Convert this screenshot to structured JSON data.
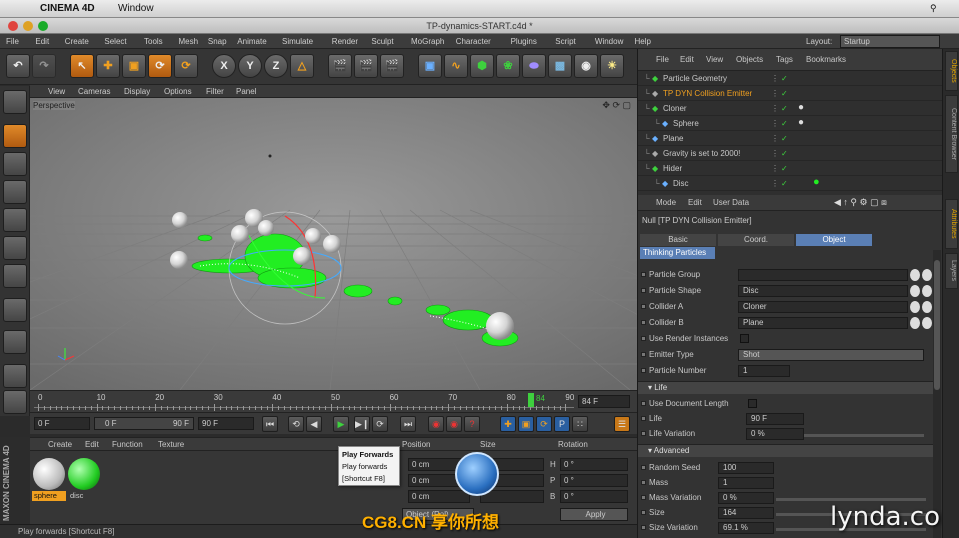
{
  "mac_menu": {
    "app": "CINEMA 4D",
    "window": "Window"
  },
  "window_title": "TP-dynamics-START.c4d *",
  "main_menu": [
    "File",
    "Edit",
    "Create",
    "Select",
    "Tools",
    "Mesh",
    "Snap",
    "Animate",
    "Simulate",
    "Render",
    "Sculpt",
    "MoGraph",
    "Character",
    "Plugins",
    "Script",
    "Window",
    "Help"
  ],
  "layout": {
    "label": "Layout:",
    "value": "Startup"
  },
  "toolbar": {
    "x": "X",
    "y": "Y",
    "z": "Z"
  },
  "viewport": {
    "menu": [
      "View",
      "Cameras",
      "Display",
      "Options",
      "Filter",
      "Panel"
    ],
    "label": "Perspective"
  },
  "timeline": {
    "ticks": [
      "0",
      "10",
      "20",
      "30",
      "40",
      "50",
      "60",
      "70",
      "80",
      "90"
    ],
    "current_frame": "84",
    "end_field": "84 F"
  },
  "transport": {
    "start": "0 F",
    "range_start": "0 F",
    "range_end": "90 F",
    "end": "90 F"
  },
  "material_manager": {
    "menu": [
      "Create",
      "Edit",
      "Function",
      "Texture"
    ],
    "materials": [
      {
        "name": "sphere",
        "color": "#d8d8d8"
      },
      {
        "name": "disc",
        "color": "#22cc22"
      }
    ]
  },
  "coordinates": {
    "headers": [
      "Position",
      "Size",
      "Rotation"
    ],
    "rows": [
      {
        "pos": "0 cm",
        "axis": "H",
        "rot": "0 °"
      },
      {
        "pos": "0 cm",
        "axis": "P",
        "rot": "0 °"
      },
      {
        "pos": "0 cm",
        "axis": "B",
        "rot": "0 °"
      }
    ],
    "object_button": "Object (Rel)",
    "apply_button": "Apply"
  },
  "tooltip": {
    "title": "Play Forwards",
    "line1": "Play forwards",
    "line2": "[Shortcut F8]"
  },
  "status": "Play forwards [Shortcut F8]",
  "maxon_logo": "MAXON CINEMA 4D",
  "object_manager": {
    "menu": [
      "File",
      "Edit",
      "View",
      "Objects",
      "Tags",
      "Bookmarks"
    ],
    "objects": [
      {
        "name": "Particle Geometry",
        "indent": 0,
        "selected": false
      },
      {
        "name": "TP DYN Collision Emitter",
        "indent": 0,
        "selected": true
      },
      {
        "name": "Cloner",
        "indent": 0,
        "selected": false
      },
      {
        "name": "Sphere",
        "indent": 1,
        "selected": false
      },
      {
        "name": "Plane",
        "indent": 0,
        "selected": false
      },
      {
        "name": "Gravity is set to 2000!",
        "indent": 0,
        "selected": false
      },
      {
        "name": "Hider",
        "indent": 0,
        "selected": false
      },
      {
        "name": "Disc",
        "indent": 1,
        "selected": false
      }
    ]
  },
  "attributes": {
    "menu": [
      "Mode",
      "Edit",
      "User Data"
    ],
    "title": "Null [TP DYN Collision Emitter]",
    "tabs": [
      "Basic",
      "Coord.",
      "Object"
    ],
    "subtab": "Thinking Particles",
    "fields": [
      {
        "label": "Particle Group",
        "value": ""
      },
      {
        "label": "Particle Shape",
        "value": "Disc"
      },
      {
        "label": "Collider A",
        "value": "Cloner"
      },
      {
        "label": "Collider B",
        "value": "Plane"
      },
      {
        "label": "Use Render Instances",
        "value": ""
      },
      {
        "label": "Emitter Type",
        "value": "Shot"
      },
      {
        "label": "Particle Number",
        "value": "1"
      }
    ],
    "life_header": "Life",
    "life_fields": [
      {
        "label": "Use Document Length",
        "value": ""
      },
      {
        "label": "Life",
        "value": "90 F"
      },
      {
        "label": "Life Variation",
        "value": "0 %"
      }
    ],
    "advanced_header": "Advanced",
    "advanced_fields": [
      {
        "label": "Random Seed",
        "value": "100"
      },
      {
        "label": "Mass",
        "value": "1"
      },
      {
        "label": "Mass Variation",
        "value": "0 %"
      },
      {
        "label": "Size",
        "value": "164"
      },
      {
        "label": "Size Variation",
        "value": "69.1 %"
      }
    ]
  },
  "right_tabs": [
    "Objects",
    "Content Browser",
    "Attributes",
    "Layers"
  ],
  "watermarks": {
    "left": "CG8.CN 享你所想",
    "right": "lynda.com"
  },
  "colors": {
    "accent_orange": "#f0a020",
    "particle_green": "#22ee22",
    "selection_blue": "#5a7fb5"
  }
}
